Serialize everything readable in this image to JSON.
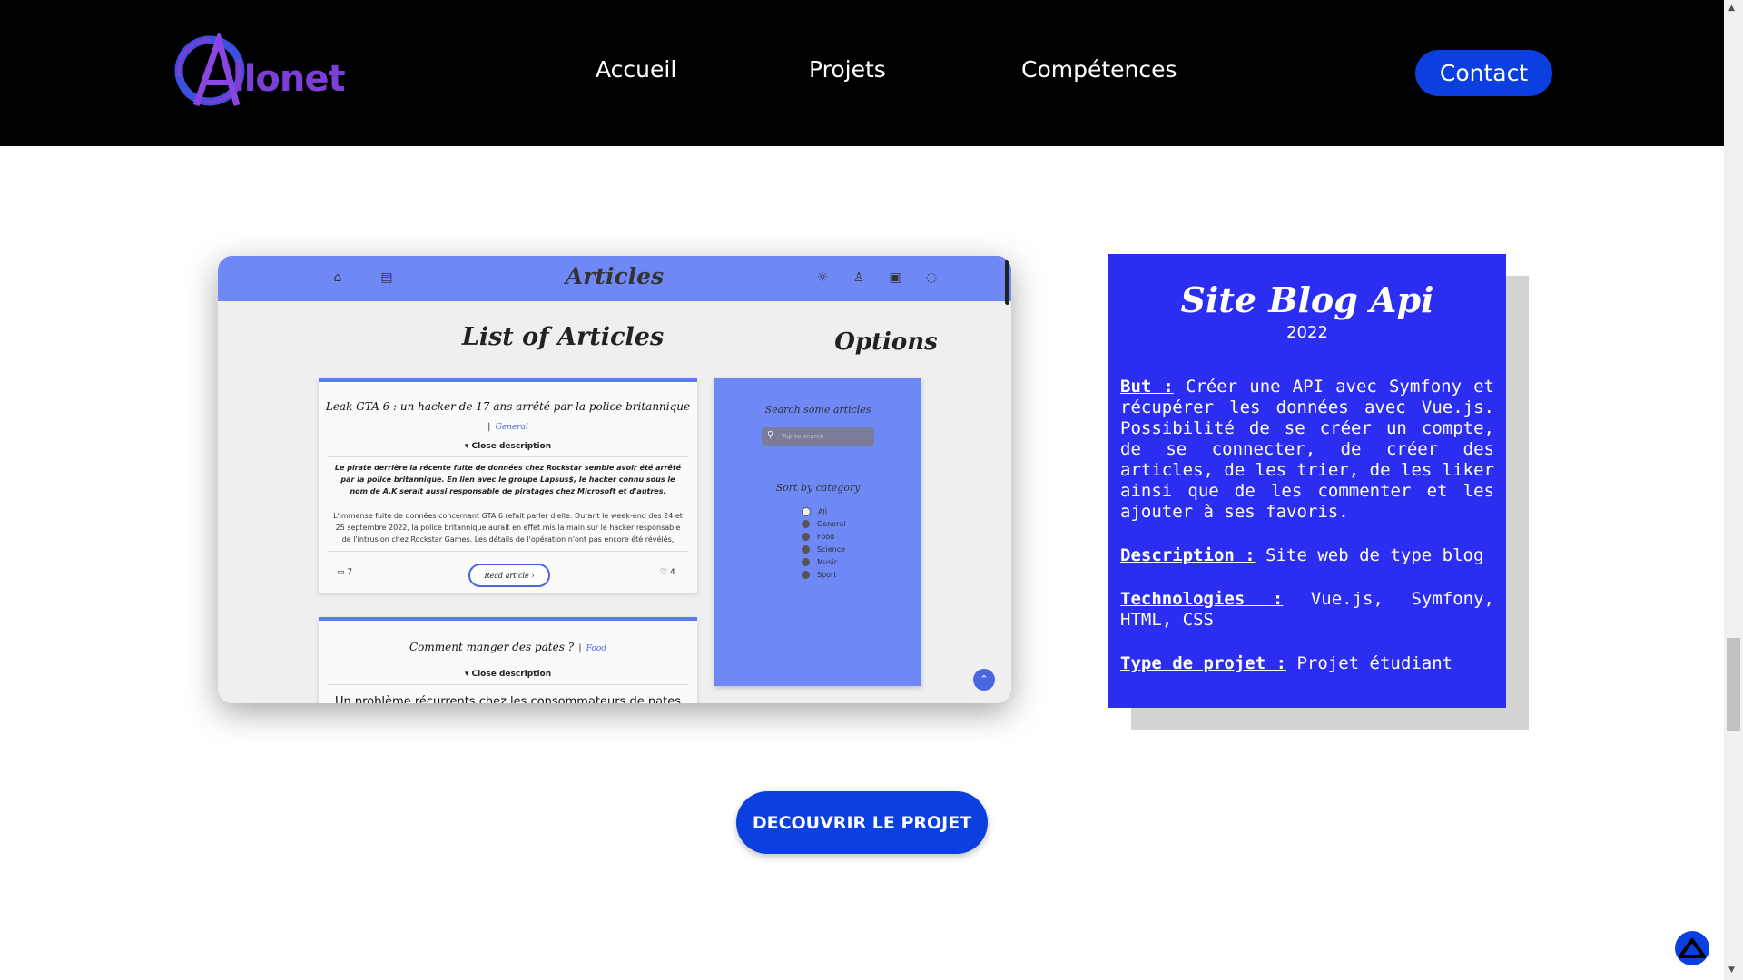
{
  "header": {
    "logo_text": "llonet",
    "nav": [
      "Accueil",
      "Projets",
      "Compétences"
    ],
    "contact_label": "Contact"
  },
  "mockup": {
    "app_title": "Articles",
    "list_title": "List of Articles",
    "options_title": "Options",
    "card1": {
      "title": "Leak GTA 6 : un hacker de 17 ans arrêté par la police britannique",
      "tag": "General",
      "close_desc": "▾ Close description",
      "summary": "Le pirate derrière la récente fuite de données chez Rockstar semble avoir été arrêté par la police britannique. En lien avec le groupe Lapsus$, le hacker connu sous le nom de A.K serait aussi responsable de piratages chez Microsoft et d'autres.",
      "body": "L'immense fuite de données concernant GTA 6 refait parler d'elle. Durant le week-end des 24 et 25 septembre 2022, la police britannique aurait en effet mis la main sur le hacker responsable de l'intrusion chez Rockstar Games. Les détails de l'opération n'ont pas encore été révélés,",
      "comments": "7",
      "read_label": "Read article",
      "likes": "4"
    },
    "card2": {
      "title": "Comment manger des pates ?",
      "tag": "Food",
      "close_desc": "▾ Close description",
      "body": "Un problème récurrents chez les consommateurs de pates"
    },
    "panel": {
      "search_label": "Search some articles",
      "search_placeholder": "Tap to search",
      "sort_label": "Sort by category",
      "categories": [
        "All",
        "General",
        "Food",
        "Science",
        "Music",
        "Sport"
      ]
    }
  },
  "project": {
    "title": "Site Blog Api",
    "year": "2022",
    "but_label": "But :",
    "but_text": "Créer une API avec Symfony et récupérer les données avec Vue.js. Possibilité de se créer un compte, de se connecter, de créer des articles, de les trier, de les liker ainsi que de les commenter et les ajouter à ses favoris.",
    "desc_label": "Description :",
    "desc_text": "Site web de type blog",
    "tech_label": "Technologies :",
    "tech_text": "Vue.js, Symfony, HTML, CSS",
    "type_label": "Type de projet :",
    "type_text": "Projet étudiant"
  },
  "cta_label": "DECOUVRIR LE PROJET",
  "colors": {
    "accent": "#0b3fe0",
    "info_bg": "#2b2ef0",
    "mock_bar": "#6e88f5"
  }
}
